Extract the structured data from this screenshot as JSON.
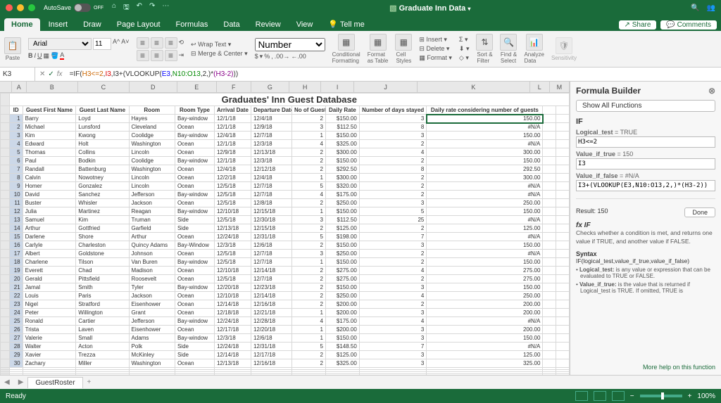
{
  "titlebar": {
    "autosave_label": "AutoSave",
    "autosave_state": "OFF",
    "doc_title": "Graduate Inn Data"
  },
  "tabs": {
    "items": [
      "Home",
      "Insert",
      "Draw",
      "Page Layout",
      "Formulas",
      "Data",
      "Review",
      "View",
      "Tell me"
    ],
    "active": "Home",
    "share": "Share",
    "comments": "Comments"
  },
  "ribbon": {
    "paste": "Paste",
    "font_name": "Arial",
    "font_size": "11",
    "wrap": "Wrap Text",
    "merge": "Merge & Center",
    "number_format": "Number",
    "currency": "$",
    "percent": "%",
    "comma": ",",
    "cond_fmt": "Conditional\nFormatting",
    "fmt_table": "Format\nas Table",
    "cell_styles": "Cell\nStyles",
    "insert": "Insert",
    "delete": "Delete",
    "format": "Format",
    "sort_filter": "Sort &\nFilter",
    "find_select": "Find &\nSelect",
    "analyze": "Analyze\nData",
    "sensitivity": "Sensitivity"
  },
  "formula_bar": {
    "cell_ref": "K3",
    "formula_parts": {
      "p1": "=IF(",
      "p2": "H3<=2",
      "p3": ",",
      "p4": "I3",
      "p5": ",",
      "p6": "I3+(VLOOKUP(",
      "p7": "E3",
      "p8": ",",
      "p9": "N10:O13",
      "p10": ",",
      "p11": "2",
      "p12": ",)*",
      "p13": "(H3-2)",
      "p14": "))"
    }
  },
  "sheet": {
    "title": "Graduates' Inn Guest Database",
    "columns": [
      "ID",
      "Guest First Name",
      "Guest Last Name",
      "Room",
      "Room Type",
      "Arrival Date",
      "Departure Date",
      "No of Guests",
      "Daily Rate",
      "Number of days stayed",
      "Daily rate considering number of guests"
    ],
    "col_letters": [
      "A",
      "B",
      "C",
      "D",
      "E",
      "F",
      "G",
      "H",
      "I",
      "J",
      "K",
      "L",
      "M"
    ],
    "rows": [
      {
        "id": 1,
        "fn": "Barry",
        "ln": "Loyd",
        "room": "Hayes",
        "rt": "Bay-window",
        "ad": "12/1/18",
        "dd": "12/4/18",
        "ng": 2,
        "dr": "$150.00",
        "nd": 3,
        "drc": "150.00"
      },
      {
        "id": 2,
        "fn": "Michael",
        "ln": "Lunsford",
        "room": "Cleveland",
        "rt": "Ocean",
        "ad": "12/1/18",
        "dd": "12/9/18",
        "ng": 3,
        "dr": "$112.50",
        "nd": 8,
        "drc": "#N/A"
      },
      {
        "id": 3,
        "fn": "Kim",
        "ln": "Kwong",
        "room": "Coolidge",
        "rt": "Bay-window",
        "ad": "12/4/18",
        "dd": "12/7/18",
        "ng": 1,
        "dr": "$150.00",
        "nd": 3,
        "drc": "150.00"
      },
      {
        "id": 4,
        "fn": "Edward",
        "ln": "Holt",
        "room": "Washington",
        "rt": "Ocean",
        "ad": "12/1/18",
        "dd": "12/3/18",
        "ng": 4,
        "dr": "$325.00",
        "nd": 2,
        "drc": "#N/A"
      },
      {
        "id": 5,
        "fn": "Thomas",
        "ln": "Collins",
        "room": "Lincoln",
        "rt": "Ocean",
        "ad": "12/9/18",
        "dd": "12/13/18",
        "ng": 2,
        "dr": "$300.00",
        "nd": 4,
        "drc": "300.00"
      },
      {
        "id": 6,
        "fn": "Paul",
        "ln": "Bodkin",
        "room": "Coolidge",
        "rt": "Bay-window",
        "ad": "12/1/18",
        "dd": "12/3/18",
        "ng": 2,
        "dr": "$150.00",
        "nd": 2,
        "drc": "150.00"
      },
      {
        "id": 7,
        "fn": "Randall",
        "ln": "Battenburg",
        "room": "Washington",
        "rt": "Ocean",
        "ad": "12/4/18",
        "dd": "12/12/18",
        "ng": 2,
        "dr": "$292.50",
        "nd": 8,
        "drc": "292.50"
      },
      {
        "id": 8,
        "fn": "Calvin",
        "ln": "Nowotney",
        "room": "Lincoln",
        "rt": "Ocean",
        "ad": "12/2/18",
        "dd": "12/4/18",
        "ng": 1,
        "dr": "$300.00",
        "nd": 2,
        "drc": "300.00"
      },
      {
        "id": 9,
        "fn": "Homer",
        "ln": "Gonzalez",
        "room": "Lincoln",
        "rt": "Ocean",
        "ad": "12/5/18",
        "dd": "12/7/18",
        "ng": 5,
        "dr": "$320.00",
        "nd": 2,
        "drc": "#N/A"
      },
      {
        "id": 10,
        "fn": "David",
        "ln": "Sanchez",
        "room": "Jefferson",
        "rt": "Bay-window",
        "ad": "12/5/18",
        "dd": "12/7/18",
        "ng": 4,
        "dr": "$175.00",
        "nd": 2,
        "drc": "#N/A"
      },
      {
        "id": 11,
        "fn": "Buster",
        "ln": "Whisler",
        "room": "Jackson",
        "rt": "Ocean",
        "ad": "12/5/18",
        "dd": "12/8/18",
        "ng": 2,
        "dr": "$250.00",
        "nd": 3,
        "drc": "250.00"
      },
      {
        "id": 12,
        "fn": "Julia",
        "ln": "Martinez",
        "room": "Reagan",
        "rt": "Bay-window",
        "ad": "12/10/18",
        "dd": "12/15/18",
        "ng": 1,
        "dr": "$150.00",
        "nd": 5,
        "drc": "150.00"
      },
      {
        "id": 13,
        "fn": "Samuel",
        "ln": "Kim",
        "room": "Truman",
        "rt": "Side",
        "ad": "12/5/18",
        "dd": "12/30/18",
        "ng": 3,
        "dr": "$112.50",
        "nd": 25,
        "drc": "#N/A"
      },
      {
        "id": 14,
        "fn": "Arthur",
        "ln": "Gottfried",
        "room": "Garfield",
        "rt": "Side",
        "ad": "12/13/18",
        "dd": "12/15/18",
        "ng": 2,
        "dr": "$125.00",
        "nd": 2,
        "drc": "125.00"
      },
      {
        "id": 15,
        "fn": "Darlene",
        "ln": "Shore",
        "room": "Arthur",
        "rt": "Ocean",
        "ad": "12/24/18",
        "dd": "12/31/18",
        "ng": 5,
        "dr": "$198.00",
        "nd": 7,
        "drc": "#N/A"
      },
      {
        "id": 16,
        "fn": "Carlyle",
        "ln": "Charleston",
        "room": "Quincy Adams",
        "rt": "Bay-Window",
        "ad": "12/3/18",
        "dd": "12/6/18",
        "ng": 2,
        "dr": "$150.00",
        "nd": 3,
        "drc": "150.00"
      },
      {
        "id": 17,
        "fn": "Albert",
        "ln": "Goldstone",
        "room": "Johnson",
        "rt": "Ocean",
        "ad": "12/5/18",
        "dd": "12/7/18",
        "ng": 3,
        "dr": "$250.00",
        "nd": 2,
        "drc": "#N/A"
      },
      {
        "id": 18,
        "fn": "Charlene",
        "ln": "Tilson",
        "room": "Van Buren",
        "rt": "Bay-window",
        "ad": "12/5/18",
        "dd": "12/7/18",
        "ng": 1,
        "dr": "$150.00",
        "nd": 2,
        "drc": "150.00"
      },
      {
        "id": 19,
        "fn": "Everett",
        "ln": "Chad",
        "room": "Madison",
        "rt": "Ocean",
        "ad": "12/10/18",
        "dd": "12/14/18",
        "ng": 2,
        "dr": "$275.00",
        "nd": 4,
        "drc": "275.00"
      },
      {
        "id": 20,
        "fn": "Gerald",
        "ln": "Pittsfield",
        "room": "Roosevelt",
        "rt": "Ocean",
        "ad": "12/5/18",
        "dd": "12/7/18",
        "ng": 2,
        "dr": "$275.00",
        "nd": 2,
        "drc": "275.00"
      },
      {
        "id": 21,
        "fn": "Jamal",
        "ln": "Smith",
        "room": "Tyler",
        "rt": "Bay-window",
        "ad": "12/20/18",
        "dd": "12/23/18",
        "ng": 2,
        "dr": "$150.00",
        "nd": 3,
        "drc": "150.00"
      },
      {
        "id": 22,
        "fn": "Louis",
        "ln": "Paris",
        "room": "Jackson",
        "rt": "Ocean",
        "ad": "12/10/18",
        "dd": "12/14/18",
        "ng": 2,
        "dr": "$250.00",
        "nd": 4,
        "drc": "250.00"
      },
      {
        "id": 23,
        "fn": "Nigel",
        "ln": "Stratford",
        "room": "Eisenhower",
        "rt": "Ocean",
        "ad": "12/14/18",
        "dd": "12/16/18",
        "ng": 2,
        "dr": "$200.00",
        "nd": 2,
        "drc": "200.00"
      },
      {
        "id": 24,
        "fn": "Peter",
        "ln": "Willington",
        "room": "Grant",
        "rt": "Ocean",
        "ad": "12/18/18",
        "dd": "12/21/18",
        "ng": 1,
        "dr": "$200.00",
        "nd": 3,
        "drc": "200.00"
      },
      {
        "id": 25,
        "fn": "Ronald",
        "ln": "Cartier",
        "room": "Jefferson",
        "rt": "Bay-window",
        "ad": "12/24/18",
        "dd": "12/28/18",
        "ng": 4,
        "dr": "$175.00",
        "nd": 4,
        "drc": "#N/A"
      },
      {
        "id": 26,
        "fn": "Trista",
        "ln": "Laven",
        "room": "Eisenhower",
        "rt": "Ocean",
        "ad": "12/17/18",
        "dd": "12/20/18",
        "ng": 1,
        "dr": "$200.00",
        "nd": 3,
        "drc": "200.00"
      },
      {
        "id": 27,
        "fn": "Valerie",
        "ln": "Small",
        "room": "Adams",
        "rt": "Bay-window",
        "ad": "12/3/18",
        "dd": "12/6/18",
        "ng": 1,
        "dr": "$150.00",
        "nd": 3,
        "drc": "150.00"
      },
      {
        "id": 28,
        "fn": "Walter",
        "ln": "Acton",
        "room": "Polk",
        "rt": "Side",
        "ad": "12/24/18",
        "dd": "12/31/18",
        "ng": 5,
        "dr": "$148.50",
        "nd": 7,
        "drc": "#N/A"
      },
      {
        "id": 29,
        "fn": "Xavier",
        "ln": "Trezza",
        "room": "McKinley",
        "rt": "Side",
        "ad": "12/14/18",
        "dd": "12/17/18",
        "ng": 2,
        "dr": "$125.00",
        "nd": 3,
        "drc": "125.00"
      },
      {
        "id": 30,
        "fn": "Zachary",
        "ln": "Miller",
        "room": "Washington",
        "rt": "Ocean",
        "ad": "12/13/18",
        "dd": "12/16/18",
        "ng": 2,
        "dr": "$325.00",
        "nd": 3,
        "drc": "325.00"
      }
    ],
    "tab_name": "GuestRoster"
  },
  "panel": {
    "title": "Formula Builder",
    "show_all": "Show All Functions",
    "fn": "IF",
    "args": [
      {
        "label": "Logical_test",
        "val": "H3<=2",
        "res": "TRUE"
      },
      {
        "label": "Value_if_true",
        "val": "I3",
        "res": "150"
      },
      {
        "label": "Value_if_false",
        "val": "I3+(VLOOKUP(E3,N10:O13,2,)*(H3-2))",
        "res": "#N/A"
      }
    ],
    "result_label": "Result:",
    "result_val": "150",
    "done": "Done",
    "fx": "fx IF",
    "desc": "Checks whether a condition is met, and returns one value if TRUE, and another value if FALSE.",
    "syntax_h": "Syntax",
    "syntax": "IF(logical_test,value_if_true,value_if_false)",
    "b1": "Logical_test: is any value or expression that can be evaluated to TRUE or FALSE.",
    "b2": "Value_if_true: is the value that is returned if Logical_test is TRUE. If omitted, TRUE is",
    "link": "More help on this function"
  },
  "status": {
    "ready": "Ready",
    "zoom": "100%"
  }
}
